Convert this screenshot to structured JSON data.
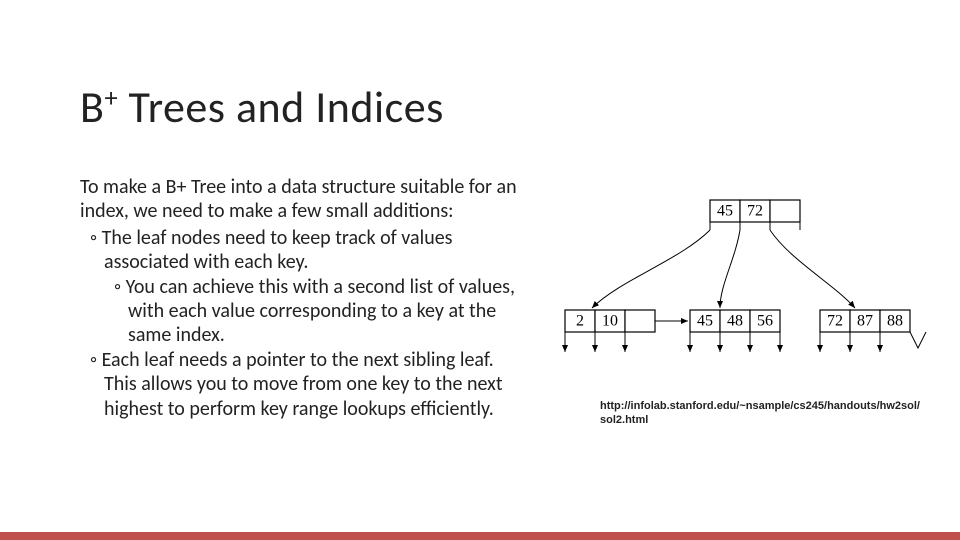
{
  "title_main": "B",
  "title_sup": "+",
  "title_rest": " Trees and Indices",
  "intro": "To make a B+ Tree into a data structure suitable for an index, we need to make a few small additions:",
  "bullets": [
    {
      "level": 1,
      "text": "The leaf nodes need to keep track of values associated with each key."
    },
    {
      "level": 2,
      "text": "You can achieve this with a second list of values, with each value corresponding to a key at the same index."
    },
    {
      "level": 1,
      "text": "Each leaf needs a pointer to the next sibling leaf. This allows you to move from one key to the next highest to perform key range lookups efficiently."
    }
  ],
  "tree": {
    "root": [
      "45",
      "72",
      ""
    ],
    "leaf1": [
      "2",
      "10",
      ""
    ],
    "leaf2": [
      "45",
      "48",
      "56"
    ],
    "leaf3": [
      "72",
      "87",
      "88"
    ]
  },
  "caption": "http://infolab.stanford.edu/~nsample/cs245/handouts/hw2sol/sol2.html"
}
